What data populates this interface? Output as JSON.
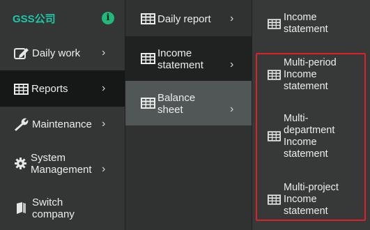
{
  "brand": {
    "name": "GSS公司"
  },
  "main_menu": {
    "items": [
      {
        "label": "Daily work",
        "icon": "edit-icon"
      },
      {
        "label": "Reports",
        "icon": "table-icon"
      },
      {
        "label": "Maintenance",
        "icon": "wrench-icon"
      },
      {
        "label": "System Management",
        "icon": "gear-icon"
      },
      {
        "label": "Switch company",
        "icon": "book-icon"
      }
    ]
  },
  "reports_menu": {
    "items": [
      {
        "label": "Daily report"
      },
      {
        "label": "Income statement"
      },
      {
        "label": "Balance sheet"
      }
    ]
  },
  "income_menu": {
    "items": [
      {
        "label": "Income statement"
      },
      {
        "label": "Multi-period Income statement"
      },
      {
        "label": "Multi-department Income statement"
      },
      {
        "label": "Multi-project Income statement"
      }
    ]
  },
  "colors": {
    "brand": "#1fc7a8",
    "highlight": "#e02028",
    "active_bg": "#151817",
    "hover_bg": "#505756"
  }
}
